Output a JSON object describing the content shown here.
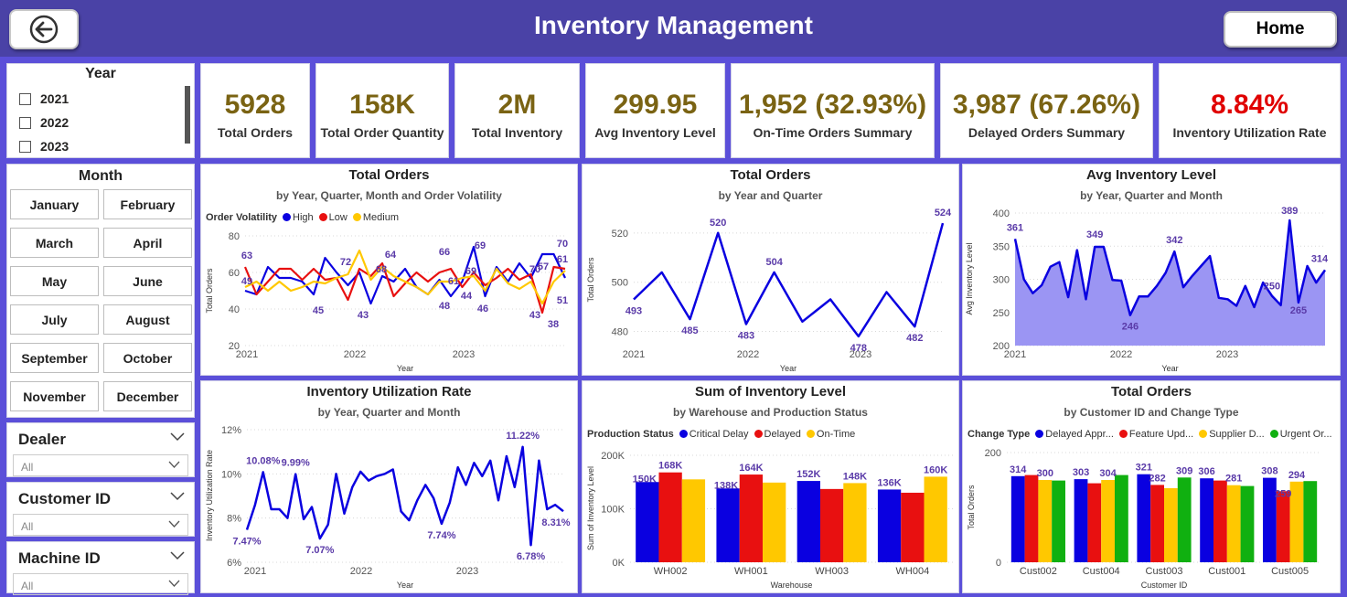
{
  "header": {
    "title": "Inventory Management",
    "home_label": "Home"
  },
  "colors": {
    "accent": "#4a42a6",
    "kpi_value": "#7a6313",
    "kpi_alert": "#e00000",
    "blue": "#0a00e0",
    "red": "#e81010",
    "yellow": "#ffc800",
    "green": "#10b010",
    "series_label": "#5a3aa8"
  },
  "kpis": [
    {
      "value": "5928",
      "label": "Total Orders"
    },
    {
      "value": "158K",
      "label": "Total Order Quantity"
    },
    {
      "value": "2M",
      "label": "Total Inventory"
    },
    {
      "value": "299.95",
      "label": "Avg Inventory Level"
    },
    {
      "value": "1,952 (32.93%)",
      "label": "On-Time Orders Summary"
    },
    {
      "value": "3,987 (67.26%)",
      "label": "Delayed Orders Summary"
    },
    {
      "value": "8.84%",
      "label": "Inventory Utilization Rate"
    }
  ],
  "filters": {
    "year": {
      "title": "Year",
      "options": [
        "2021",
        "2022",
        "2023"
      ]
    },
    "month": {
      "title": "Month",
      "options": [
        "January",
        "February",
        "March",
        "April",
        "May",
        "June",
        "July",
        "August",
        "September",
        "October",
        "November",
        "December"
      ]
    },
    "dealer": {
      "label": "Dealer",
      "value": "All"
    },
    "customer": {
      "label": "Customer ID",
      "value": "All"
    },
    "machine": {
      "label": "Machine ID",
      "value": "All"
    }
  },
  "chart_data": [
    {
      "id": "c1",
      "type": "line",
      "title": "Total Orders",
      "subtitle": "by Year, Quarter, Month and Order Volatility",
      "legend_title": "Order Volatility",
      "xlabel": "Year",
      "ylabel": "Total Orders",
      "ylim": [
        20,
        80
      ],
      "yticks": [
        "20",
        "40",
        "60",
        "80"
      ],
      "xticks": [
        "2021",
        "2022",
        "2023"
      ],
      "series": [
        {
          "name": "High",
          "values": [
            50,
            48,
            63,
            57,
            57,
            55,
            48,
            68,
            60,
            53,
            60,
            43,
            58,
            55,
            62,
            52,
            48,
            56,
            47,
            55,
            74,
            47,
            63,
            55,
            65,
            57,
            70,
            70,
            57
          ]
        },
        {
          "name": "Low",
          "values": [
            63,
            48,
            55,
            62,
            62,
            56,
            62,
            56,
            57,
            45,
            62,
            58,
            65,
            47,
            54,
            60,
            55,
            60,
            62,
            52,
            60,
            53,
            57,
            62,
            56,
            59,
            38,
            63,
            62
          ]
        },
        {
          "name": "Medium",
          "values": [
            52,
            55,
            50,
            55,
            50,
            52,
            55,
            54,
            57,
            59,
            72,
            56,
            63,
            58,
            55,
            52,
            48,
            55,
            55,
            57,
            58,
            50,
            62,
            54,
            51,
            55,
            43,
            55,
            61
          ]
        }
      ],
      "labels": [
        "63",
        "49",
        "72",
        "43",
        "68",
        "64",
        "45",
        "66",
        "61",
        "48",
        "44",
        "69",
        "46",
        "69",
        "70",
        "57",
        "61",
        "70",
        "43",
        "38",
        "51"
      ]
    },
    {
      "id": "c2",
      "type": "line",
      "title": "Total Orders",
      "subtitle": "by Year and Quarter",
      "xlabel": "Year",
      "ylabel": "Total Orders",
      "ylim": [
        475,
        527
      ],
      "yticks": [
        "480",
        "500",
        "520"
      ],
      "xticks": [
        "2021",
        "2022",
        "2023"
      ],
      "series": [
        {
          "name": "",
          "values": [
            493,
            504,
            485,
            520,
            483,
            504,
            484,
            493,
            478,
            496,
            482,
            524
          ]
        }
      ],
      "labels": [
        "493",
        "485",
        "520",
        "483",
        "504",
        "478",
        "482",
        "524"
      ]
    },
    {
      "id": "c3",
      "type": "area",
      "title": "Avg Inventory Level",
      "subtitle": "by Year, Quarter and Month",
      "xlabel": "Year",
      "ylabel": "Avg Inventory Level",
      "ylim": [
        200,
        400
      ],
      "yticks": [
        "200",
        "250",
        "300",
        "350",
        "400"
      ],
      "xticks": [
        "2021",
        "2022",
        "2023"
      ],
      "series": [
        {
          "name": "",
          "values": [
            361,
            300,
            279,
            291,
            319,
            326,
            273,
            344,
            270,
            349,
            349,
            299,
            298,
            246,
            274,
            274,
            290,
            310,
            342,
            288,
            305,
            320,
            335,
            272,
            270,
            260,
            290,
            258,
            295,
            275,
            261,
            389,
            265,
            320,
            295,
            314
          ]
        }
      ],
      "labels": [
        "361",
        "349",
        "246",
        "342",
        "250",
        "389",
        "265",
        "314"
      ]
    },
    {
      "id": "c4",
      "type": "line",
      "title": "Inventory Utilization Rate",
      "subtitle": "by Year, Quarter and Month",
      "xlabel": "Year",
      "ylabel": "Inventory Utilization Rate",
      "ylim": [
        6,
        12
      ],
      "yticks": [
        "6%",
        "8%",
        "10%",
        "12%"
      ],
      "xticks": [
        "2021",
        "2022",
        "2023"
      ],
      "series": [
        {
          "name": "",
          "values": [
            7.47,
            8.6,
            10.08,
            8.4,
            8.4,
            8.0,
            9.99,
            7.95,
            8.5,
            7.07,
            7.7,
            10.0,
            8.2,
            9.4,
            10.1,
            9.7,
            9.9,
            10.0,
            10.2,
            8.3,
            7.9,
            8.8,
            9.5,
            8.9,
            7.74,
            8.7,
            10.3,
            9.5,
            10.5,
            9.9,
            10.6,
            8.8,
            10.8,
            9.4,
            11.22,
            6.78,
            10.6,
            8.4,
            8.6,
            8.31
          ]
        }
      ],
      "labels": [
        "10.08%",
        "9.99%",
        "7.47%",
        "7.07%",
        "7.74%",
        "11.22%",
        "6.78%",
        "8.31%"
      ]
    },
    {
      "id": "c5",
      "type": "bar",
      "title": "Sum of Inventory Level",
      "subtitle": "by Warehouse and Production Status",
      "legend_title": "Production Status",
      "xlabel": "Warehouse",
      "ylabel": "Sum of Inventory Level",
      "ylim": [
        0,
        200000
      ],
      "yticks": [
        "0K",
        "100K",
        "200K"
      ],
      "categories": [
        "WH002",
        "WH001",
        "WH003",
        "WH004"
      ],
      "series": [
        {
          "name": "Critical Delay",
          "values": [
            150000,
            138000,
            152000,
            136000
          ]
        },
        {
          "name": "Delayed",
          "values": [
            168000,
            164000,
            137000,
            130000
          ]
        },
        {
          "name": "On-Time",
          "values": [
            155000,
            149000,
            148000,
            160000
          ]
        }
      ],
      "labels": [
        "150K",
        "168K",
        "138K",
        "164K",
        "152K",
        "148K",
        "136K",
        "160K"
      ]
    },
    {
      "id": "c6",
      "type": "bar",
      "title": "Total Orders",
      "subtitle": "by Customer ID and Change Type",
      "legend_title": "Change Type",
      "xlabel": "Customer ID",
      "ylabel": "Total Orders",
      "ylim": [
        0,
        400
      ],
      "yticks": [
        "0",
        "200"
      ],
      "categories": [
        "Cust002",
        "Cust004",
        "Cust003",
        "Cust001",
        "Cust005"
      ],
      "series": [
        {
          "name": "Delayed Appr...",
          "values": [
            314,
            303,
            321,
            306,
            308
          ]
        },
        {
          "name": "Feature Upd...",
          "values": [
            318,
            288,
            282,
            298,
            259
          ]
        },
        {
          "name": "Supplier D...",
          "values": [
            300,
            300,
            270,
            281,
            294
          ]
        },
        {
          "name": "Urgent Or...",
          "values": [
            298,
            318,
            309,
            278,
            296
          ]
        }
      ],
      "labels": [
        "314",
        "300",
        "303",
        "304",
        "321",
        "282",
        "309",
        "306",
        "281",
        "308",
        "259",
        "294"
      ]
    }
  ]
}
